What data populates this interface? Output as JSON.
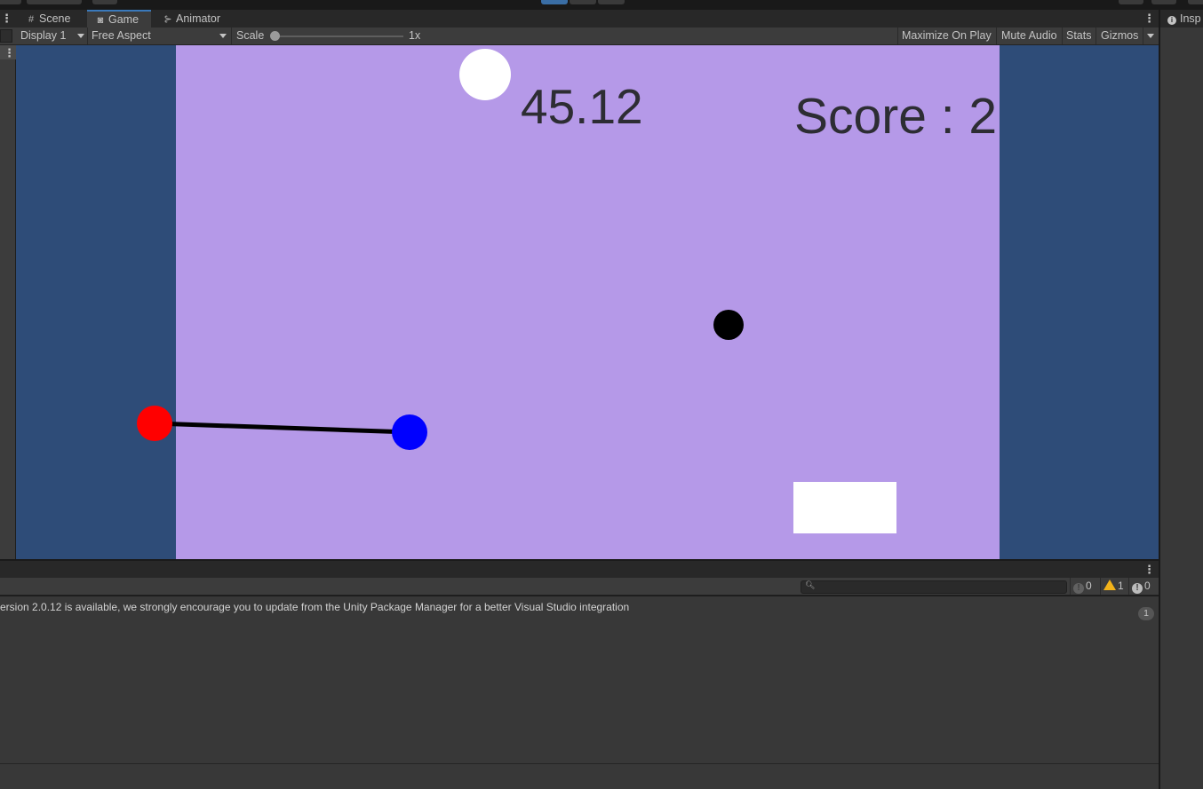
{
  "tabs": [
    {
      "label": "Scene",
      "icon": "grid-icon",
      "active": false
    },
    {
      "label": "Game",
      "icon": "gamepad-icon",
      "active": true
    },
    {
      "label": "Animator",
      "icon": "animator-icon",
      "active": false
    }
  ],
  "game_toolbar": {
    "display": "Display 1",
    "aspect": "Free Aspect",
    "scale_label": "Scale",
    "scale_value": "1x",
    "maximize_on_play": "Maximize On Play",
    "mute_audio": "Mute Audio",
    "stats": "Stats",
    "gizmos": "Gizmos"
  },
  "game": {
    "timer": "45.12",
    "score": "Score : 2",
    "colors": {
      "background": "#2e4c78",
      "canvas": "#b599e8",
      "red_ball": "#ff0000",
      "blue_ball": "#0000ff",
      "black_ball": "#000000",
      "white_ball": "#ffffff",
      "rope": "#000000",
      "text": "#2d2d33"
    }
  },
  "console": {
    "search_placeholder": "",
    "info_count": "0",
    "warning_count": "1",
    "error_count": "0",
    "log_message": "ersion 2.0.12 is available, we strongly encourage you to update from the Unity Package Manager for a better Visual Studio integration",
    "log_count": "1"
  },
  "inspector": {
    "tab_label": "Insp"
  }
}
